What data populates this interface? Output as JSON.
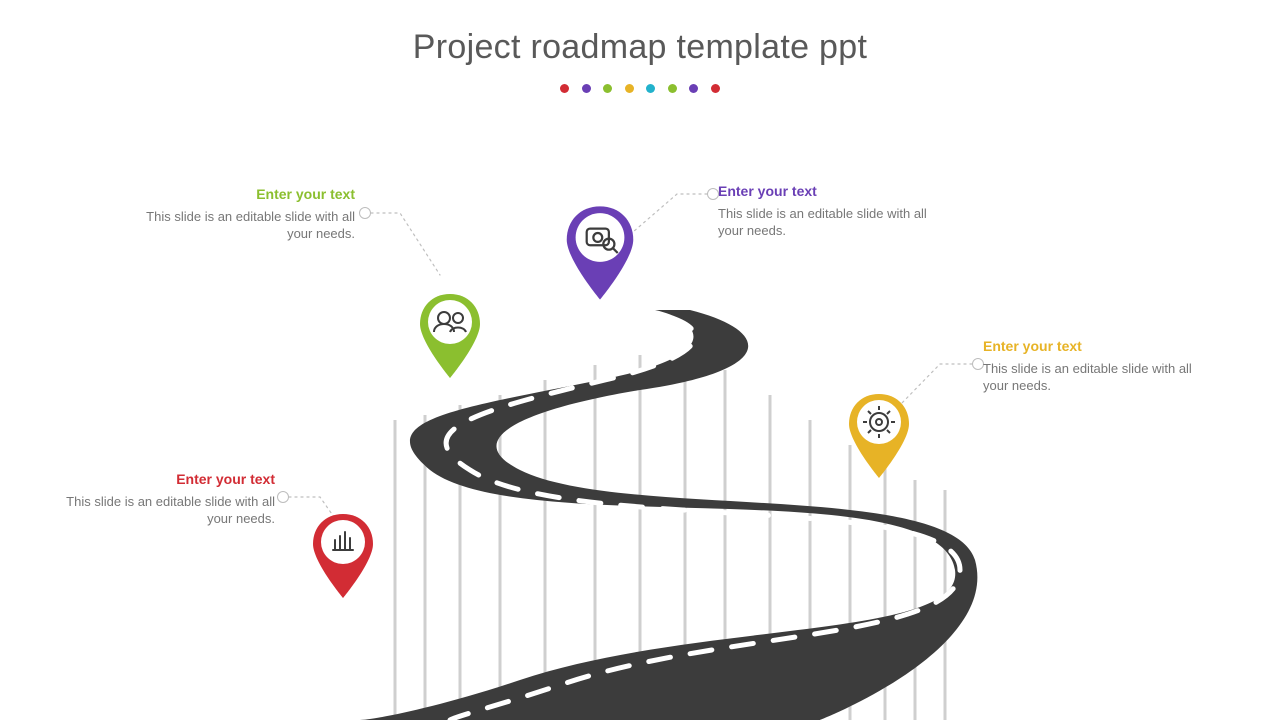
{
  "title": "Project roadmap template ppt",
  "title_dot_colors": [
    "#d22c34",
    "#6a3fb5",
    "#8bbf2f",
    "#e7b326",
    "#22b2cc",
    "#8bbf2f",
    "#6a3fb5",
    "#d22c34"
  ],
  "callouts": {
    "red": {
      "title": "Enter your text",
      "body": "This slide is an editable slide with all your needs."
    },
    "green": {
      "title": "Enter your text",
      "body": "This slide is an editable slide with all your needs."
    },
    "purple": {
      "title": "Enter your text",
      "body": "This slide is an editable slide with all your needs."
    },
    "yellow": {
      "title": "Enter your text",
      "body": "This slide is an editable slide with all your needs."
    }
  },
  "colors": {
    "red": "#d22c34",
    "green": "#8bbf2f",
    "purple": "#6a3fb5",
    "yellow": "#e7b326"
  }
}
